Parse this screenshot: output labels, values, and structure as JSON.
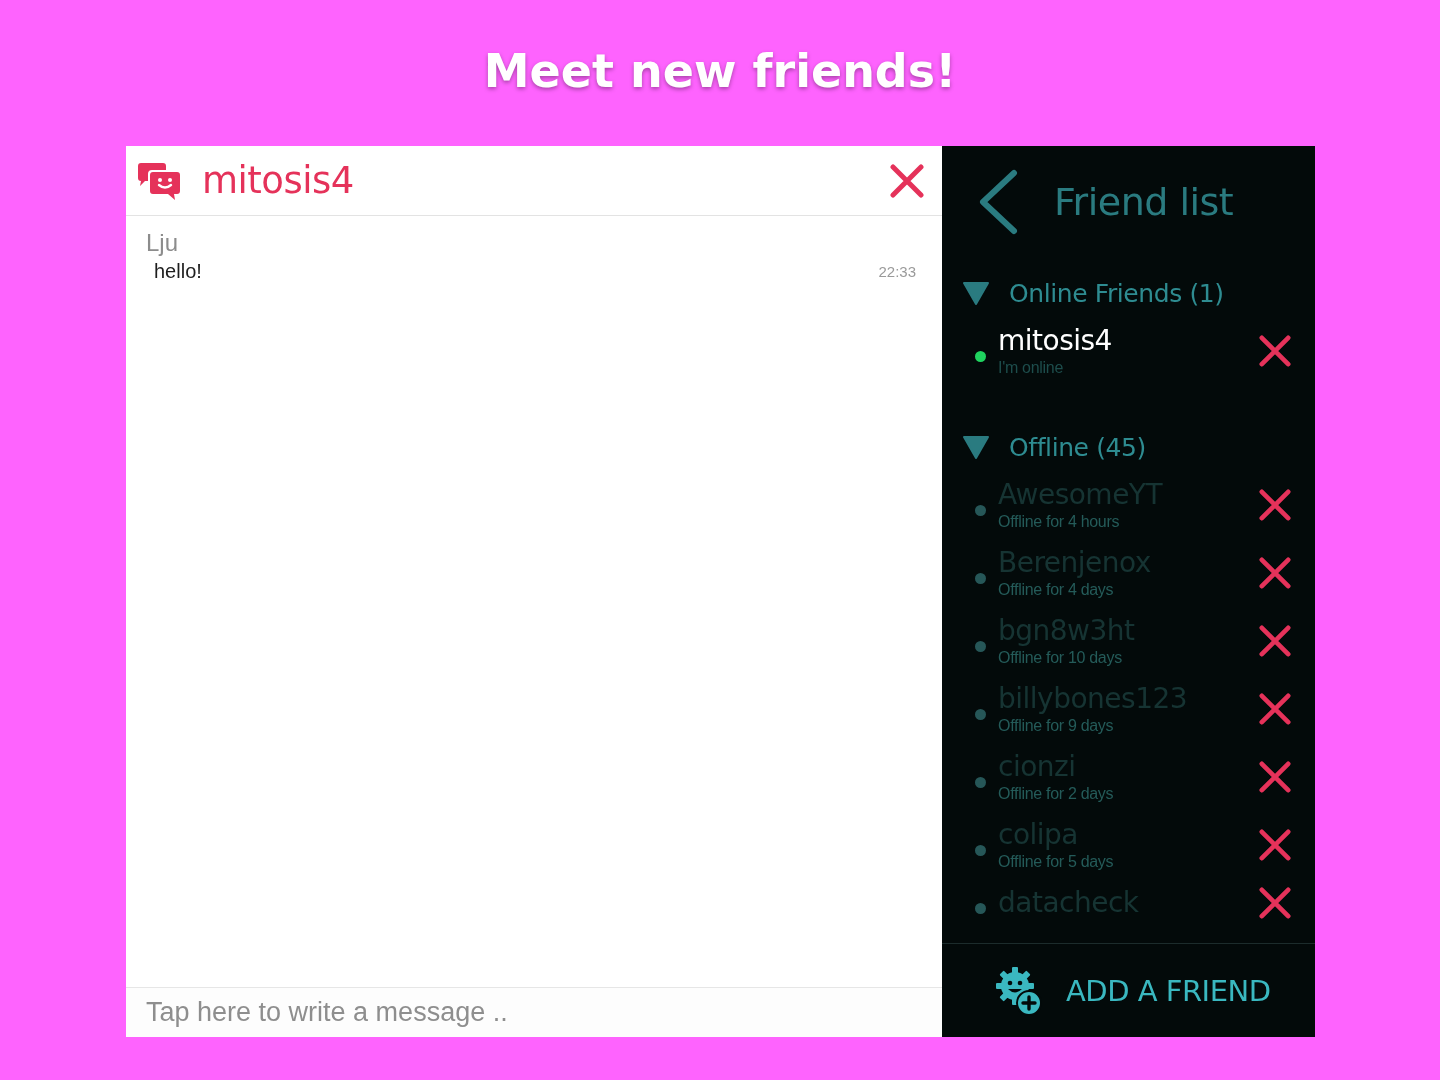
{
  "headline": "Meet new friends!",
  "chat": {
    "title": "mitosis4",
    "messages": [
      {
        "sender": "Lju",
        "text": "hello!",
        "time": "22:33"
      }
    ],
    "input": {
      "placeholder": "Tap here to write a message .."
    }
  },
  "friend_list": {
    "title": "Friend list",
    "groups": [
      {
        "label": "Online Friends (1)",
        "expanded": true,
        "friends": [
          {
            "name": "mitosis4",
            "status": "I'm online",
            "online": true
          }
        ]
      },
      {
        "label": "Offline (45)",
        "expanded": true,
        "friends": [
          {
            "name": "AwesomeYT",
            "status": "Offline for 4 hours",
            "online": false
          },
          {
            "name": "Berenjenox",
            "status": "Offline for 4 days",
            "online": false
          },
          {
            "name": "bgn8w3ht",
            "status": "Offline for 10 days",
            "online": false
          },
          {
            "name": "billybones123",
            "status": "Offline for 9 days",
            "online": false
          },
          {
            "name": "cionzi",
            "status": "Offline for 2 days",
            "online": false
          },
          {
            "name": "colipa",
            "status": "Offline for 5 days",
            "online": false
          },
          {
            "name": "datacheck",
            "online": false
          }
        ]
      }
    ],
    "add_button": "ADD A FRIEND"
  }
}
